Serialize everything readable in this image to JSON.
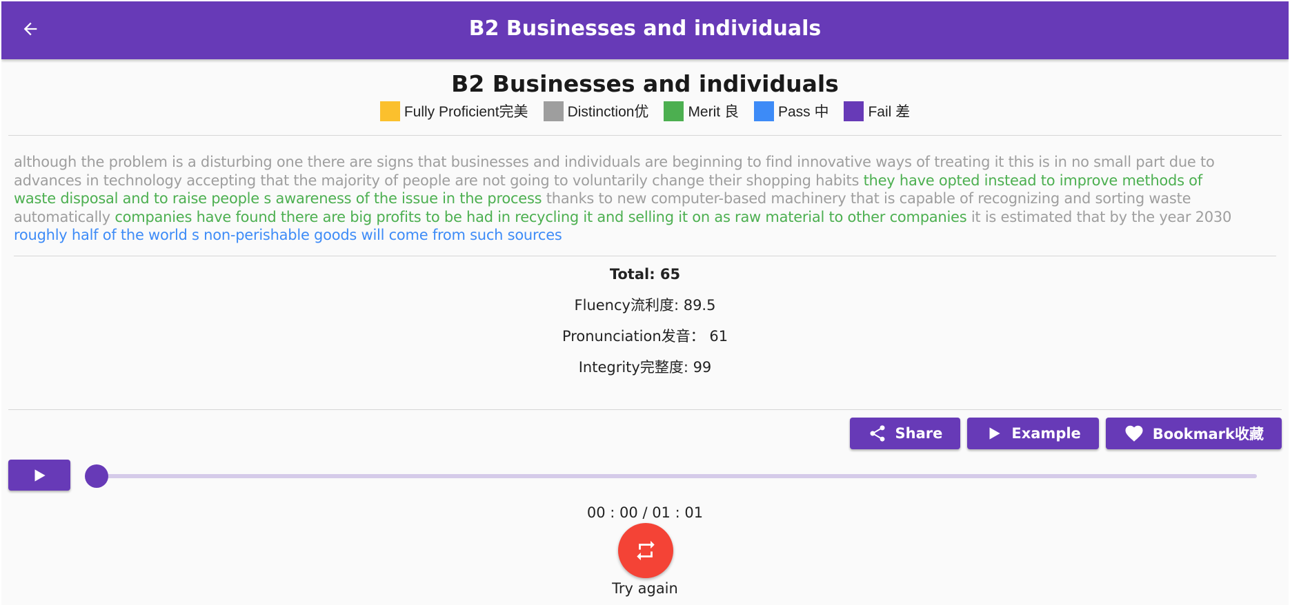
{
  "appbar": {
    "title": "B2 Businesses and individuals"
  },
  "page": {
    "title": "B2 Businesses and individuals"
  },
  "legend": [
    {
      "label": "Fully Proficient完美",
      "color": "#fbc02d"
    },
    {
      "label": "Distinction优",
      "color": "#9e9e9e"
    },
    {
      "label": "Merit 良",
      "color": "#4caf50"
    },
    {
      "label": "Pass 中",
      "color": "#3d8bf7"
    },
    {
      "label": "Fail 差",
      "color": "#673ab7"
    }
  ],
  "passage": [
    {
      "text": "although the problem is a disturbing one there are signs that businesses and individuals are beginning to find innovative ways of treating it this is in no small part due to advances in technology accepting that the majority of people are not going to voluntarily change their shopping habits ",
      "color": "#9e9e9e"
    },
    {
      "text": "they have opted instead to improve methods of waste disposal and to raise people s awareness of the issue in the process",
      "color": "#4caf50"
    },
    {
      "text": " thanks to new computer-based machinery that is capable of recognizing and sorting waste automatically ",
      "color": "#9e9e9e"
    },
    {
      "text": "companies have found there are big profits to be had in recycling it and selling it on as raw material to other companies",
      "color": "#4caf50"
    },
    {
      "text": " it is estimated that by the year 2030 ",
      "color": "#9e9e9e"
    },
    {
      "text": "roughly half of the world s non-perishable goods will come from such sources",
      "color": "#3d8bf7"
    }
  ],
  "scores": {
    "total": "Total: 65",
    "fluency": "Fluency流利度: 89.5",
    "pronunciation": "Pronunciation发音： 61",
    "integrity": "Integrity完整度: 99"
  },
  "actions": {
    "share": "Share",
    "example": "Example",
    "bookmark": "Bookmark收藏"
  },
  "player": {
    "progress": 0,
    "time": "00 : 00 / 01 : 01"
  },
  "retry": {
    "label": "Try again"
  },
  "icons": {
    "back": "arrow-left-icon",
    "share": "share-icon",
    "example": "play-icon",
    "bookmark": "heart-icon",
    "player": "play-icon",
    "retry": "repeat-icon"
  },
  "colors": {
    "primary": "#673ab7",
    "retry": "#f44336",
    "track": "#d5cbe9"
  }
}
